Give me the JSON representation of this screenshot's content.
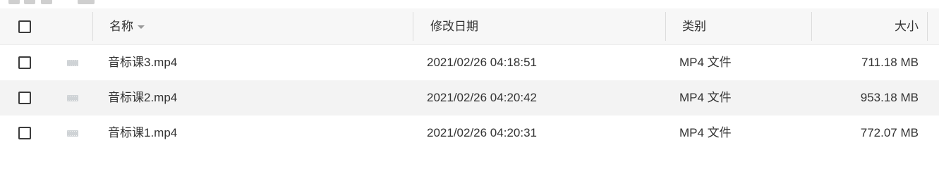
{
  "columns": {
    "name": "名称",
    "modified": "修改日期",
    "type": "类别",
    "size": "大小"
  },
  "icons": {
    "file": "video-file-icon",
    "sort": "sort-desc-icon"
  },
  "files": [
    {
      "name": "音标课3.mp4",
      "modified": "2021/02/26 04:18:51",
      "type": "MP4 文件",
      "size": "711.18 MB"
    },
    {
      "name": "音标课2.mp4",
      "modified": "2021/02/26 04:20:42",
      "type": "MP4 文件",
      "size": "953.18 MB"
    },
    {
      "name": "音标课1.mp4",
      "modified": "2021/02/26 04:20:31",
      "type": "MP4 文件",
      "size": "772.07 MB"
    }
  ]
}
